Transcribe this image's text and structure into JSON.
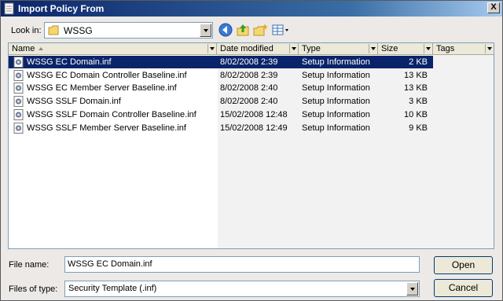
{
  "window": {
    "title": "Import Policy From",
    "close_label": "X"
  },
  "lookin": {
    "label": "Look in:",
    "value": "WSSG"
  },
  "toolbar": {
    "icons": [
      "back-icon",
      "up-folder-icon",
      "new-folder-icon",
      "views-icon"
    ]
  },
  "columns": [
    "Name",
    "Date modified",
    "Type",
    "Size",
    "Tags"
  ],
  "files": [
    {
      "name": "WSSG EC Domain.inf",
      "date": "8/02/2008 2:39",
      "type": "Setup Information",
      "size": "2 KB",
      "selected": true
    },
    {
      "name": "WSSG EC Domain Controller Baseline.inf",
      "date": "8/02/2008 2:39",
      "type": "Setup Information",
      "size": "13 KB",
      "selected": false
    },
    {
      "name": "WSSG EC Member Server Baseline.inf",
      "date": "8/02/2008 2:40",
      "type": "Setup Information",
      "size": "13 KB",
      "selected": false
    },
    {
      "name": "WSSG SSLF Domain.inf",
      "date": "8/02/2008 2:40",
      "type": "Setup Information",
      "size": "3 KB",
      "selected": false
    },
    {
      "name": "WSSG SSLF Domain Controller Baseline.inf",
      "date": "15/02/2008 12:48",
      "type": "Setup Information",
      "size": "10 KB",
      "selected": false
    },
    {
      "name": "WSSG SSLF Member Server Baseline.inf",
      "date": "15/02/2008 12:49",
      "type": "Setup Information",
      "size": "9 KB",
      "selected": false
    }
  ],
  "filename": {
    "label": "File name:",
    "value": "WSSG EC Domain.inf"
  },
  "filetype": {
    "label": "Files of type:",
    "value": "Security Template (.inf)"
  },
  "buttons": {
    "open": "Open",
    "cancel": "Cancel"
  }
}
